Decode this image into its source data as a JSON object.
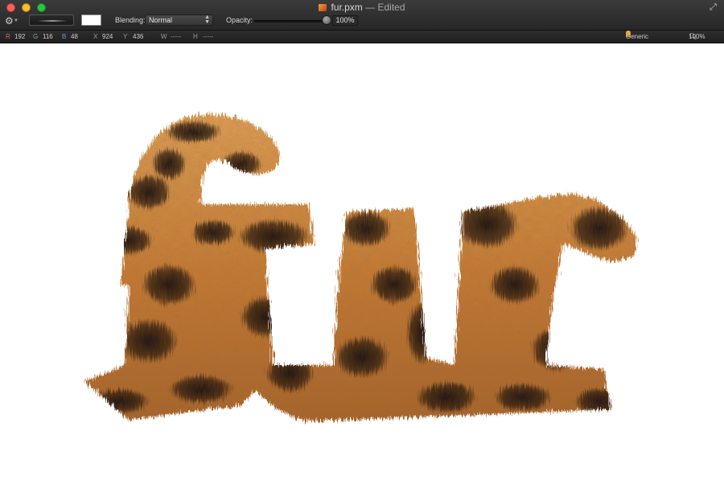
{
  "window": {
    "filename": "fur.pxm",
    "separator": "—",
    "status": "Edited"
  },
  "toolbar": {
    "gear_icon": "gear-icon",
    "blending_label": "Blending:",
    "blending_value": "Normal",
    "opacity_label": "Opacity:",
    "opacity_value": "100%",
    "swatch_color": "#ffffff"
  },
  "infobar": {
    "r_label": "R",
    "r_value": "192",
    "g_label": "G",
    "g_value": "116",
    "b_label": "B",
    "b_value": "48",
    "x_label": "X",
    "x_value": "924",
    "y_label": "Y",
    "y_value": "436",
    "w_label": "W",
    "w_value": "-----",
    "h_label": "H",
    "h_value": "-----",
    "color_profile": "Generic RGB",
    "zoom": "100%"
  },
  "canvas": {
    "text": "fur",
    "fur_base_color": "#c97a30",
    "fur_light_color": "#e8a65a",
    "fur_spot_color": "#1e1510"
  },
  "colors": {
    "r_channel": "#e06464",
    "g_channel": "#69c46a",
    "b_channel": "#5e9bdc"
  }
}
